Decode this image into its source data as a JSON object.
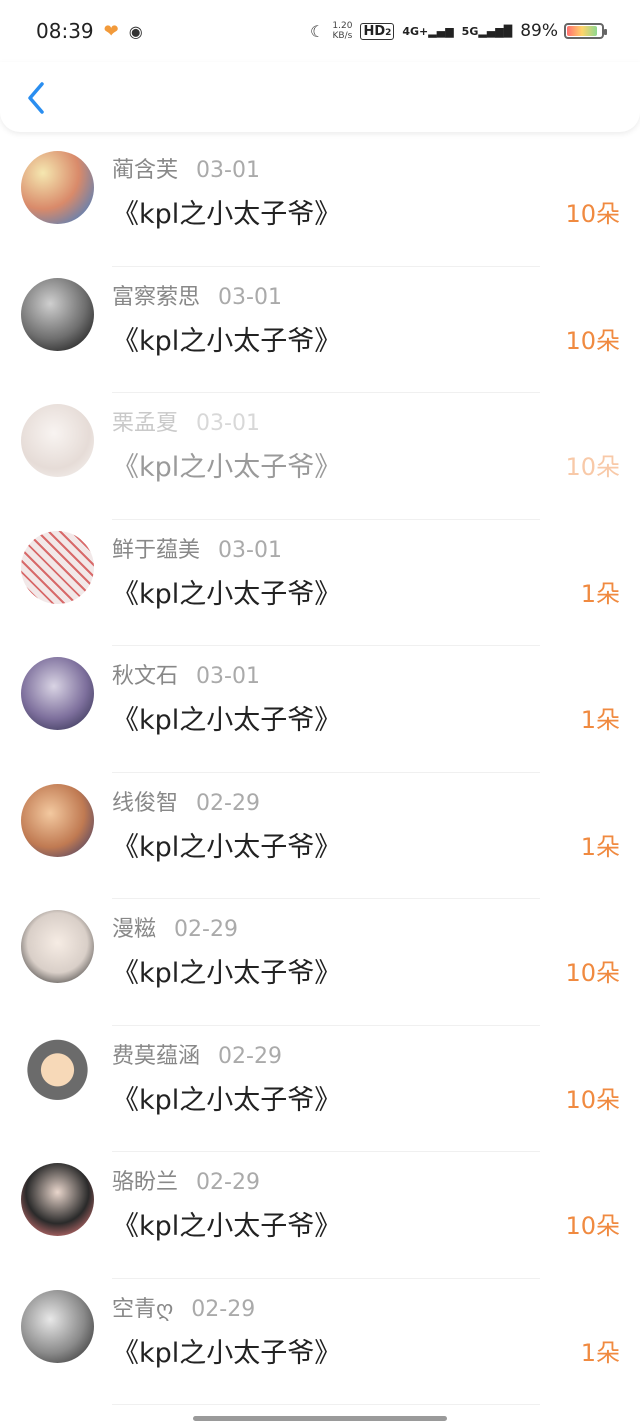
{
  "status_bar": {
    "time": "08:39",
    "net_speed_value": "1.20",
    "net_speed_unit": "KB/s",
    "hd_label": "HD",
    "hd_sub": "2",
    "network_4g": "4G+",
    "network_5g": "5G",
    "battery_percent": "89%",
    "battery_level": 0.89
  },
  "nav": {
    "back_icon": "chevron-left-icon"
  },
  "list": {
    "items": [
      {
        "name": "蔺含芙",
        "date": "03-01",
        "title": "《kpl之小太子爷》",
        "gift": "10朵"
      },
      {
        "name": "富察萦思",
        "date": "03-01",
        "title": "《kpl之小太子爷》",
        "gift": "10朵"
      },
      {
        "name": "栗孟夏",
        "date": "03-01",
        "title": "《kpl之小太子爷》",
        "gift": "10朵"
      },
      {
        "name": "鲜于蕴美",
        "date": "03-01",
        "title": "《kpl之小太子爷》",
        "gift": "1朵"
      },
      {
        "name": "秋文石",
        "date": "03-01",
        "title": "《kpl之小太子爷》",
        "gift": "1朵"
      },
      {
        "name": "线俊智",
        "date": "02-29",
        "title": "《kpl之小太子爷》",
        "gift": "1朵"
      },
      {
        "name": "漫糍",
        "date": "02-29",
        "title": "《kpl之小太子爷》",
        "gift": "10朵"
      },
      {
        "name": "费莫蕴涵",
        "date": "02-29",
        "title": "《kpl之小太子爷》",
        "gift": "10朵"
      },
      {
        "name": "骆盼兰",
        "date": "02-29",
        "title": "《kpl之小太子爷》",
        "gift": "10朵"
      },
      {
        "name": "空青ღ",
        "date": "02-29",
        "title": "《kpl之小太子爷》",
        "gift": "1朵"
      }
    ]
  },
  "colors": {
    "accent_blue": "#2a8ef0",
    "gift_orange": "#f08a40"
  }
}
